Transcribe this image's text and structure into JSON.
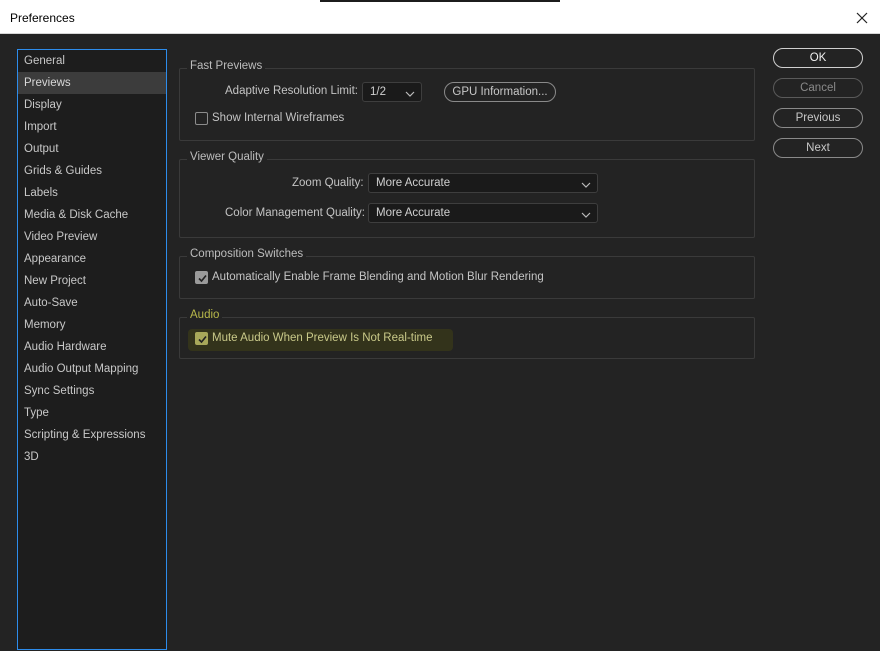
{
  "window": {
    "title": "Preferences"
  },
  "sidebar": {
    "items": [
      {
        "label": "General"
      },
      {
        "label": "Previews",
        "selected": true
      },
      {
        "label": "Display"
      },
      {
        "label": "Import"
      },
      {
        "label": "Output"
      },
      {
        "label": "Grids & Guides"
      },
      {
        "label": "Labels"
      },
      {
        "label": "Media & Disk Cache"
      },
      {
        "label": "Video Preview"
      },
      {
        "label": "Appearance"
      },
      {
        "label": "New Project"
      },
      {
        "label": "Auto-Save"
      },
      {
        "label": "Memory"
      },
      {
        "label": "Audio Hardware"
      },
      {
        "label": "Audio Output Mapping"
      },
      {
        "label": "Sync Settings"
      },
      {
        "label": "Type"
      },
      {
        "label": "Scripting & Expressions"
      },
      {
        "label": "3D"
      }
    ]
  },
  "fast_previews": {
    "title": "Fast Previews",
    "resolution_label": "Adaptive Resolution Limit:",
    "resolution_value": "1/2",
    "gpu_button": "GPU Information...",
    "wireframes_label": "Show Internal Wireframes",
    "wireframes_checked": false
  },
  "viewer_quality": {
    "title": "Viewer Quality",
    "zoom_label": "Zoom Quality:",
    "zoom_value": "More Accurate",
    "color_label": "Color Management Quality:",
    "color_value": "More Accurate"
  },
  "composition_switches": {
    "title": "Composition Switches",
    "blend_label": "Automatically Enable Frame Blending and Motion Blur Rendering",
    "blend_checked": true
  },
  "audio": {
    "title": "Audio",
    "mute_label": "Mute Audio When Preview Is Not Real-time",
    "mute_checked": true
  },
  "buttons": {
    "ok": "OK",
    "cancel": "Cancel",
    "previous": "Previous",
    "next": "Next"
  },
  "colors": {
    "background": "#232323",
    "sidebar_border": "#2d8ceb",
    "audio_highlight": "#b8b84a"
  }
}
